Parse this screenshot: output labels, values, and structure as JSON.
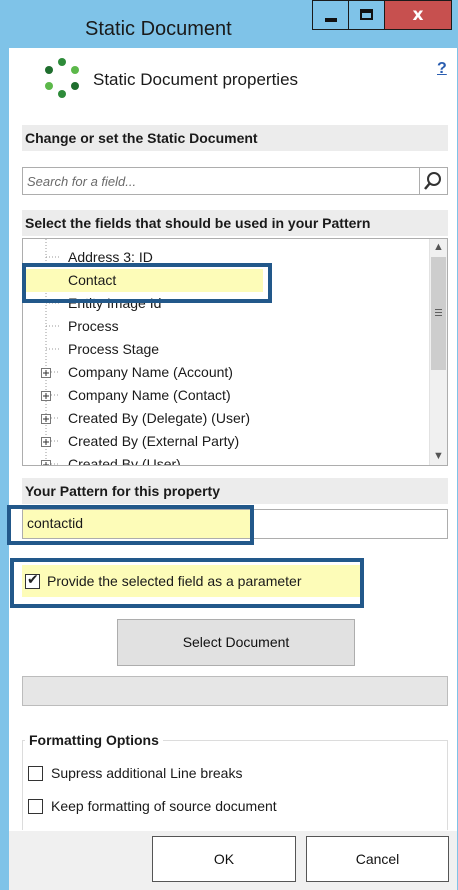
{
  "window": {
    "title": "Static Document"
  },
  "titlebar_buttons": {
    "minimize_icon": "minimize-icon",
    "maximize_icon": "maximize-icon",
    "close_label": "x"
  },
  "header": {
    "title": "Static Document properties",
    "help": "?",
    "logo_icon": "crm-logo-icon",
    "logo_colors": [
      "#2e8b3a",
      "#5cb84a",
      "#1f6e2e"
    ]
  },
  "sections": {
    "change": "Change or set the Static Document",
    "fields": "Select the fields that should be used in your Pattern",
    "pattern": "Your Pattern for this property"
  },
  "search": {
    "placeholder": "Search for a field...",
    "icon": "search-icon"
  },
  "tree": {
    "items": [
      {
        "label": "Address 3: ID",
        "expandable": false
      },
      {
        "label": "Contact",
        "expandable": false,
        "highlighted": true
      },
      {
        "label": "Entity Image Id",
        "expandable": false
      },
      {
        "label": "Process",
        "expandable": false
      },
      {
        "label": "Process Stage",
        "expandable": false
      },
      {
        "label": "Company Name (Account)",
        "expandable": true
      },
      {
        "label": "Company Name (Contact)",
        "expandable": true
      },
      {
        "label": "Created By (Delegate) (User)",
        "expandable": true
      },
      {
        "label": "Created By (External Party)",
        "expandable": true
      },
      {
        "label": "Created By (User)",
        "expandable": true
      }
    ]
  },
  "pattern": {
    "value": "contactid"
  },
  "parameter_checkbox": {
    "label": "Provide the selected field as a parameter",
    "checked": true
  },
  "select_document_button": "Select Document",
  "formatting": {
    "title": "Formatting Options",
    "options": [
      {
        "label": "Supress additional Line breaks",
        "checked": false
      },
      {
        "label": "Keep formatting of source document",
        "checked": false
      }
    ]
  },
  "footer": {
    "ok": "OK",
    "cancel": "Cancel"
  },
  "colors": {
    "titlebar": "#7fc3e8",
    "close": "#c7504f",
    "highlight": "#fdfcb8",
    "callout_border": "#22588a"
  }
}
